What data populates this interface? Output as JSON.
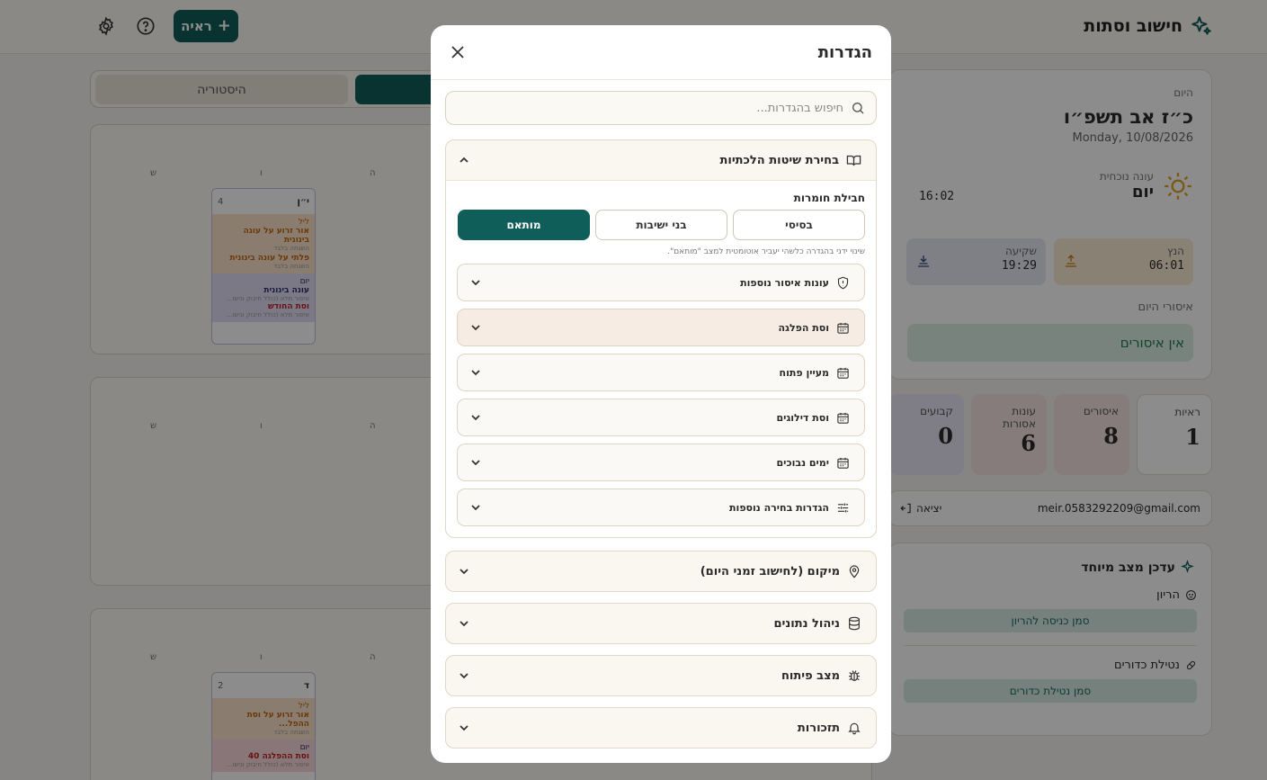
{
  "app": {
    "title": "חישוב וסתות",
    "add_label": "ראיה"
  },
  "tabs": {
    "history": "היסטוריה"
  },
  "calendar": {
    "day_headers": [
      "ש",
      "ו",
      "ה"
    ],
    "card1": {
      "day_num": "4",
      "day_heb": "י״ן",
      "night_label": "ליל",
      "night_e1": "אור זרוע על עונה בינונית",
      "night_e1_sub": "השגחה בלבד",
      "night_e2": "פלתי על עונה בינונית",
      "night_e2_sub": "השגחה בלבד",
      "day_label": "יום",
      "day_e1": "עונה בינונית",
      "day_e1_sub": "איסור מלא (כולל חיבוק ונישו...",
      "day_e2": "וסת החודש",
      "day_e2_sub": "איסור מלא (כולל חיבוק ונישו..."
    },
    "card3": {
      "day_num": "2",
      "day_heb": "ד",
      "night_label": "ליל",
      "night_e1": "אור זרוע על וסת ההפל...",
      "night_e1_sub": "השגחה בלבד",
      "day_label": "יום",
      "day_e1": "וסת ההפלגה 40",
      "day_e1_sub": "איסור מלא (כולל חיבוק ונישו..."
    }
  },
  "today": {
    "kicker": "היום",
    "hebrew_date": "כ״ז אב תשפ״ו",
    "greg_date": "Monday, 10/08/2026",
    "onah_label": "עונה נוכחית",
    "onah_value": "יום",
    "clock": "16:02",
    "sunrise_label": "הנץ",
    "sunrise": "06:01",
    "sunset_label": "שקיעה",
    "sunset": "19:29",
    "restrictions_label": "איסורי היום",
    "no_restrictions": "אין איסורים"
  },
  "stats": [
    {
      "label": "ראיות",
      "value": "1",
      "color": "#ffffff"
    },
    {
      "label": "איסורים",
      "value": "8",
      "color": "#f4e2e2"
    },
    {
      "label": "עונות אסורות",
      "value": "6",
      "color": "#f4e2e2"
    },
    {
      "label": "קבועים",
      "value": "0",
      "color": "#e8e6f4"
    }
  ],
  "account": {
    "email": "meir.0583292209@gmail.com",
    "logout": "יציאה"
  },
  "special": {
    "title": "עדכן מצב מיוחד",
    "pregnancy": "הריון",
    "pregnancy_btn": "סמן כניסה להריון",
    "pills": "נטילת כדורים",
    "pills_btn": "סמן נטילת כדורים"
  },
  "modal": {
    "title": "הגדרות",
    "search_placeholder": "חיפוש בהגדרות...",
    "halachic": {
      "title": "בחירת שיטות הלכתיות",
      "preset_label": "חבילת חומרות",
      "presets": [
        "בסיסי",
        "בני ישיבות",
        "מותאם"
      ],
      "selected_preset": "מותאם",
      "hint": "שינוי ידני בהגדרה כלשהי יעביר אוטומטית למצב \"מותאם\".",
      "items": [
        "עונות איסור נוספות",
        "וסת הפלגה",
        "מעיין פתוח",
        "וסת דילוגים",
        "ימים נבוכים",
        "הגדרות בחירה נוספות"
      ]
    },
    "sections": [
      "מיקום (לחישוב זמני היום)",
      "ניהול נתונים",
      "מצב פיתוח",
      "תזכורות"
    ]
  },
  "colors": {
    "accent": "#0f5e5a",
    "overlay": "rgba(0,0,0,0.45)"
  }
}
